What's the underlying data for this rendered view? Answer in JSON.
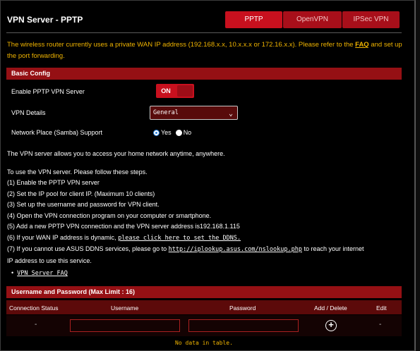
{
  "header": {
    "title": "VPN Server - PPTP",
    "tabs": [
      {
        "label": "PPTP",
        "active": true
      },
      {
        "label": "OpenVPN",
        "active": false
      },
      {
        "label": "IPSec VPN",
        "active": false
      }
    ]
  },
  "notice": {
    "text": "The wireless router currently uses a private WAN IP address (192.168.x.x, 10.x.x.x or 172.16.x.x). Please refer to the",
    "link": "FAQ",
    "text_after": "and set up the port forwarding."
  },
  "basic_config": {
    "section_title": "Basic Config",
    "enable_label": "Enable PPTP VPN Server",
    "enable_state": "ON",
    "details_label": "VPN Details",
    "details_value": "General",
    "samba_label": "Network Place (Samba) Support",
    "samba_yes": "Yes",
    "samba_no": "No"
  },
  "info": {
    "intro": "The VPN server allows you to access your home network anytime, anywhere.",
    "steps_title": "To use the VPN server. Please follow these steps.",
    "step1": "(1) Enable the PPTP VPN server",
    "step2": "(2) Set the IP pool for client IP. (Maximum 10 clients)",
    "step3": "(3) Set up the username and password for VPN client.",
    "step4": "(4) Open the VPN connection program on your computer or smartphone.",
    "step5": "(5) Add a new PPTP VPN connection and the VPN server address is192.168.1.115",
    "step6_text": "(6) If your WAN IP address is dynamic,",
    "step6_link": "please click here to set the DDNS.",
    "step7_text": "(7) If you cannot use ASUS DDNS services, please go to",
    "step7_link": "http://iplookup.asus.com/nslookup.php",
    "step7_after": "to reach your internet",
    "step7_line2": "IP address to use this service.",
    "faq_link": "VPN Server FAQ"
  },
  "users": {
    "section_title": "Username and Password (Max Limit : 16)",
    "columns": [
      "Connection Status",
      "Username",
      "Password",
      "Add / Delete",
      "Edit"
    ],
    "row_status": "-",
    "row_edit": "-",
    "add_icon": "plus-circle-icon",
    "no_data": "No data in table."
  }
}
